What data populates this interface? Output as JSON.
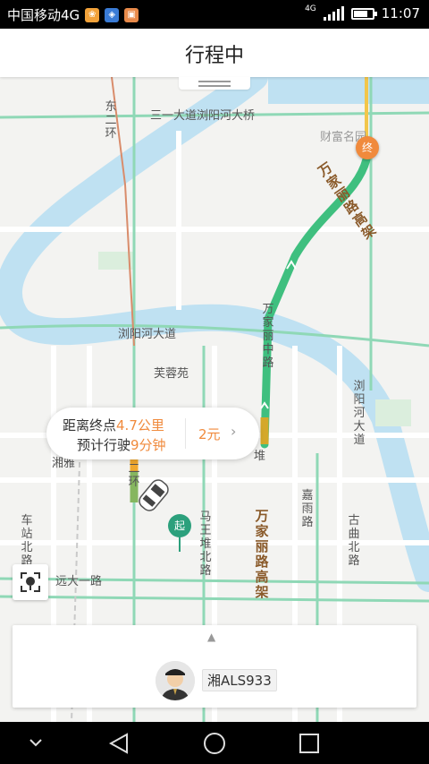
{
  "status_bar": {
    "carrier": "中国移动4G",
    "net_label": "4G",
    "time": "11:07"
  },
  "header": {
    "title": "行程中"
  },
  "map": {
    "roads": {
      "sanyi_bridge": "三一大道浏阳河大桥",
      "east2_ring": "东二环",
      "liuyang_avenue": "浏阳河大道",
      "furong_yuan": "芙蓉苑",
      "wanjiali_elevated_top": "万家丽路高架",
      "wanjiali_middle": "万家丽中路",
      "liuyanghe_avenue_right": "浏阳河大道",
      "xiangya": "湘雅",
      "east2_ring_lower": "二环",
      "chezhan_north": "车站北路",
      "mawangdui_north": "马王堆北路",
      "wanjiali_elevated_bottom": "万家丽路高架",
      "jiayu": "嘉雨路",
      "guqu_north": "古曲北路",
      "yuanda1": "远大一路",
      "caifu": "财富名园",
      "dui": "堆"
    },
    "end_marker": "终",
    "start_marker": "起",
    "route_color": "#3fbf7f",
    "accent_color": "#f08a3c",
    "river_color": "#bfe1f2"
  },
  "trip_info": {
    "distance_prefix": "距离终点",
    "distance_value": "4.7公里",
    "eta_prefix": "预计行驶",
    "eta_value": "9分钟",
    "price": "2元"
  },
  "driver_panel": {
    "plate": "湘ALS933"
  }
}
